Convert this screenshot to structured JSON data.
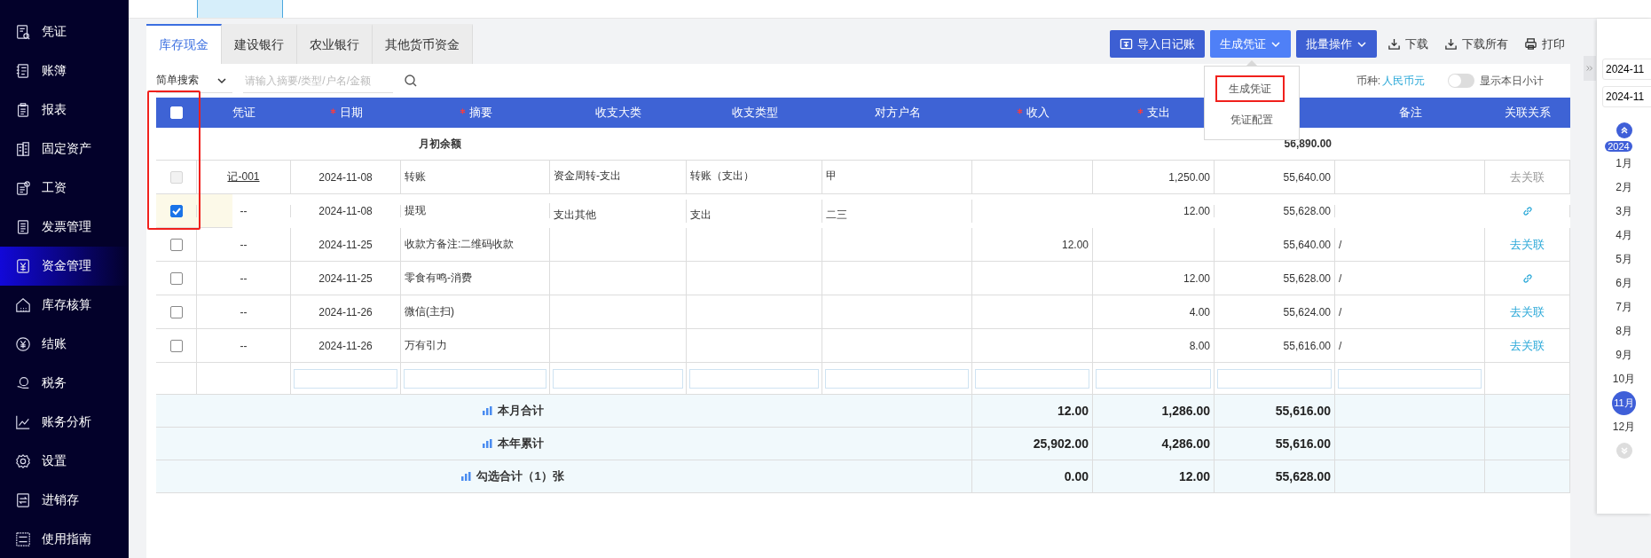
{
  "sidebar": {
    "items": [
      {
        "label": "凭证",
        "selected": false
      },
      {
        "label": "账簿",
        "selected": false
      },
      {
        "label": "报表",
        "selected": false
      },
      {
        "label": "固定资产",
        "selected": false
      },
      {
        "label": "工资",
        "selected": false
      },
      {
        "label": "发票管理",
        "selected": false
      },
      {
        "label": "资金管理",
        "selected": true
      },
      {
        "label": "库存核算",
        "selected": false
      },
      {
        "label": "结账",
        "selected": false
      },
      {
        "label": "税务",
        "selected": false
      },
      {
        "label": "账务分析",
        "selected": false
      },
      {
        "label": "设置",
        "selected": false
      },
      {
        "label": "进销存",
        "selected": false
      },
      {
        "label": "使用指南",
        "selected": false
      }
    ]
  },
  "tabs": [
    {
      "label": "库存现金",
      "selected": true
    },
    {
      "label": "建设银行",
      "selected": false
    },
    {
      "label": "农业银行",
      "selected": false
    },
    {
      "label": "其他货币资金",
      "selected": false
    }
  ],
  "toolbar": [
    {
      "label": "导入日记账",
      "kind": "import"
    },
    {
      "label": "生成凭证",
      "kind": "dropdown",
      "expanded": true
    },
    {
      "label": "批量操作",
      "kind": "dropdown",
      "expanded": false
    },
    {
      "label": "下载",
      "kind": "download"
    },
    {
      "label": "下载所有",
      "kind": "download"
    },
    {
      "label": "打印",
      "kind": "print"
    }
  ],
  "dropdown_menu": {
    "items": [
      "生成凭证",
      "凭证配置"
    ]
  },
  "search": {
    "mode": "简单搜索",
    "placeholder": "请输入摘要/类型/户名/金额"
  },
  "currency": {
    "label": "币种:",
    "value": "人民币元"
  },
  "daily_subtotal": {
    "label": "显示本日小计",
    "on": false
  },
  "table": {
    "header_checkbox": {
      "checked": false
    },
    "columns": [
      {
        "label": "凭证",
        "required": false
      },
      {
        "label": "日期",
        "required": true
      },
      {
        "label": "摘要",
        "required": true
      },
      {
        "label": "收支大类",
        "required": false
      },
      {
        "label": "收支类型",
        "required": false
      },
      {
        "label": "对方户名",
        "required": false
      },
      {
        "label": "收入",
        "required": true
      },
      {
        "label": "支出",
        "required": true
      },
      {},
      {
        "label": "备注",
        "required": false
      },
      {
        "label": "关联关系",
        "required": false
      }
    ],
    "opening_balance": {
      "label": "月初余额",
      "balance": "56,890.00"
    },
    "rows": [
      {
        "checked": false,
        "disabled": true,
        "voucher": "记-001",
        "date": "2024-11-08",
        "summary": "转账",
        "category": "资金周转-支出",
        "type": "转账（支出）",
        "counterparty": "甲",
        "expense": "1,250.00",
        "balance": "55,640.00",
        "relation": {
          "kind": "text",
          "label": "去关联",
          "disabled": true
        }
      },
      {
        "checked": true,
        "disabled": false,
        "voucher": "--",
        "date": "2024-11-08",
        "summary": "提现",
        "category": "支出其他",
        "type": "支出",
        "counterparty": "二三",
        "expense": "12.00",
        "balance": "55,628.00",
        "relation": {
          "kind": "icon"
        }
      },
      {
        "checked": false,
        "disabled": false,
        "voucher": "--",
        "date": "2024-11-25",
        "summary": "收款方备注:二维码收款",
        "income": "12.00",
        "balance": "55,640.00",
        "note": "/",
        "relation": {
          "kind": "text",
          "label": "去关联",
          "disabled": false
        }
      },
      {
        "checked": false,
        "disabled": false,
        "voucher": "--",
        "date": "2024-11-25",
        "summary": "零食有鸣-消费",
        "expense": "12.00",
        "balance": "55,628.00",
        "note": "/",
        "relation": {
          "kind": "icon"
        }
      },
      {
        "checked": false,
        "disabled": false,
        "voucher": "--",
        "date": "2024-11-26",
        "summary": "微信(主扫)",
        "expense": "4.00",
        "balance": "55,624.00",
        "note": "/",
        "relation": {
          "kind": "text",
          "label": "去关联",
          "disabled": false
        }
      },
      {
        "checked": false,
        "disabled": false,
        "voucher": "--",
        "date": "2024-11-26",
        "summary": "万有引力",
        "expense": "8.00",
        "balance": "55,616.00",
        "note": "/",
        "relation": {
          "kind": "text",
          "label": "去关联",
          "disabled": false
        }
      }
    ],
    "summaries": [
      {
        "label": "本月合计",
        "income": "12.00",
        "expense": "1,286.00",
        "balance": "55,616.00"
      },
      {
        "label": "本年累计",
        "income": "25,902.00",
        "expense": "4,286.00",
        "balance": "55,616.00"
      },
      {
        "label": "勾选合计（1）张",
        "income": "0.00",
        "expense": "12.00",
        "balance": "55,628.00"
      }
    ]
  },
  "calendar": {
    "inputs": [
      "2024-11",
      "2024-11"
    ],
    "year": "2024",
    "months": [
      {
        "label": "1月",
        "selected": false
      },
      {
        "label": "2月",
        "selected": false
      },
      {
        "label": "3月",
        "selected": false
      },
      {
        "label": "4月",
        "selected": false
      },
      {
        "label": "5月",
        "selected": false
      },
      {
        "label": "6月",
        "selected": false
      },
      {
        "label": "7月",
        "selected": false
      },
      {
        "label": "8月",
        "selected": false
      },
      {
        "label": "9月",
        "selected": false
      },
      {
        "label": "10月",
        "selected": false
      },
      {
        "label": "11月",
        "selected": true
      },
      {
        "label": "12月",
        "selected": false
      }
    ]
  }
}
